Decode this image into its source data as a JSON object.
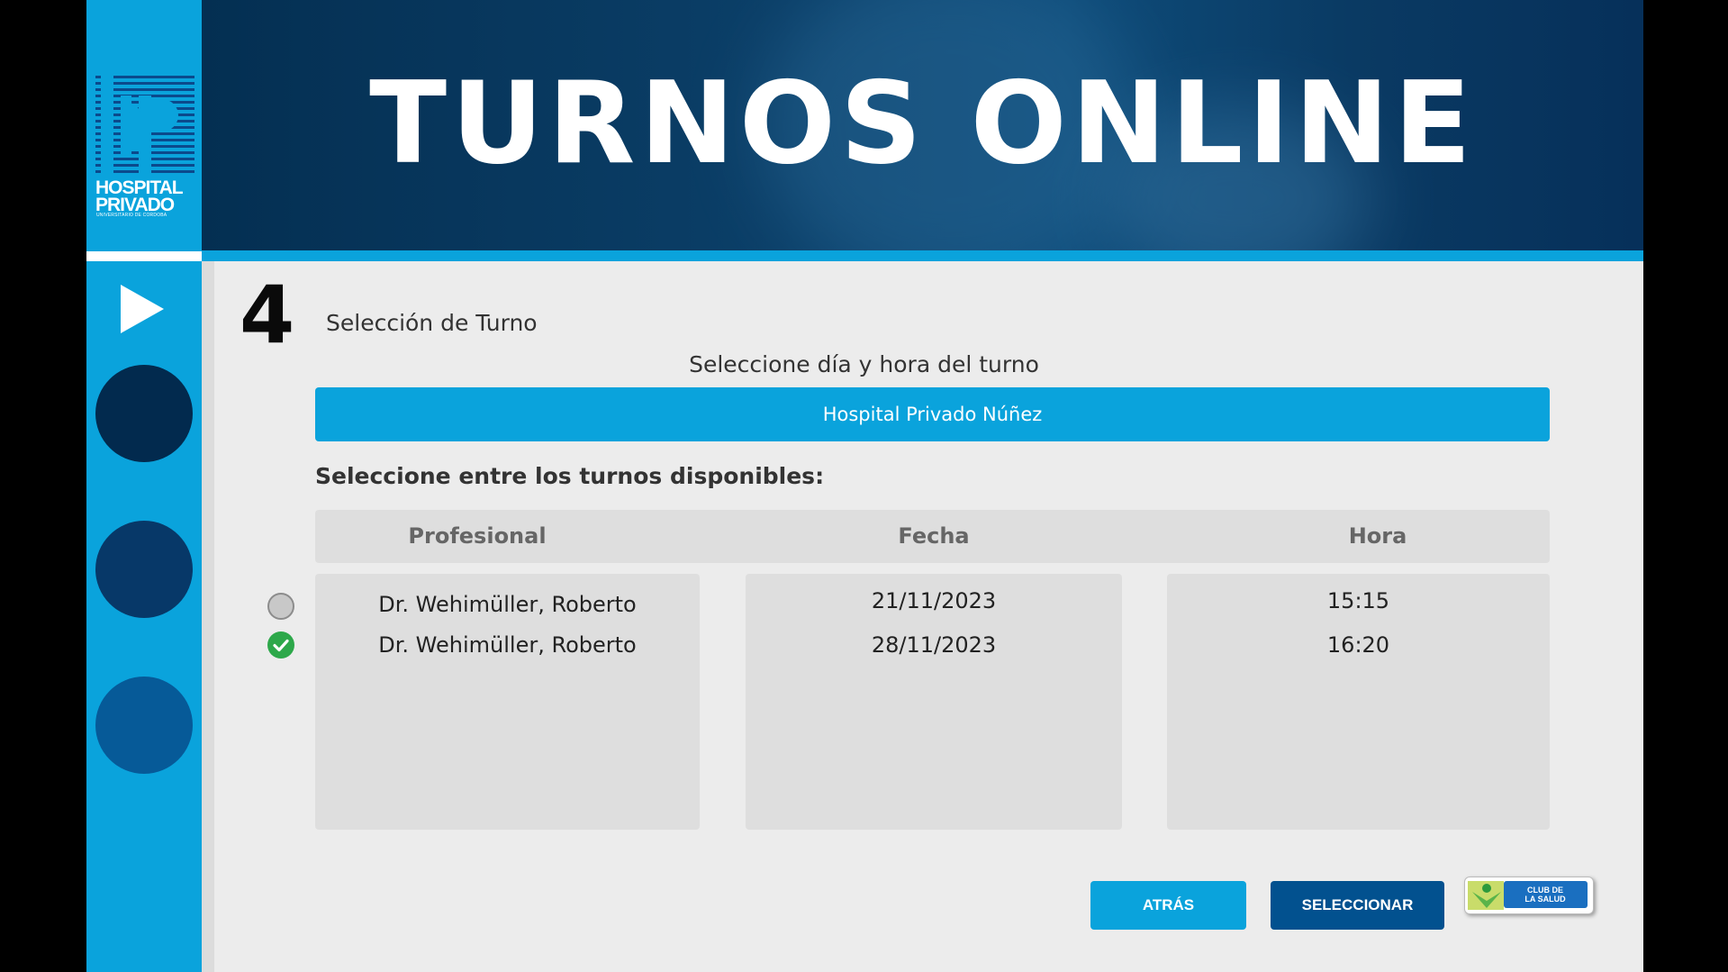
{
  "brand": {
    "name_line1": "HOSPITAL",
    "name_line2": "PRIVADO",
    "name_line3": "UNIVERSITARIO DE CORDOBA"
  },
  "header": {
    "title": "TURNOS ONLINE"
  },
  "step": {
    "number": "4",
    "title": "Selección de Turno"
  },
  "instruction": "Seleccione día y hora del turno",
  "hospital": "Hospital Privado Núñez",
  "available_label": "Seleccione entre los turnos disponibles:",
  "table": {
    "headers": [
      "Profesional",
      "Fecha",
      "Hora"
    ],
    "rows": [
      {
        "profesional": "Dr. Wehimüller, Roberto",
        "fecha": "21/11/2023",
        "hora": "15:15",
        "selected": false
      },
      {
        "profesional": "Dr. Wehimüller, Roberto",
        "fecha": "28/11/2023",
        "hora": "16:20",
        "selected": true
      }
    ]
  },
  "buttons": {
    "back": "ATRÁS",
    "select": "SELECCIONAR"
  },
  "club_logo": {
    "line1": "CLUB DE",
    "line2": "LA SALUD"
  },
  "colors": {
    "accent": "#0aa3dc",
    "dark_blue": "#02518f",
    "selected_green": "#2da84a",
    "step_circle_1": "#022a4e",
    "step_circle_2": "#073868",
    "step_circle_3": "#065a98"
  }
}
